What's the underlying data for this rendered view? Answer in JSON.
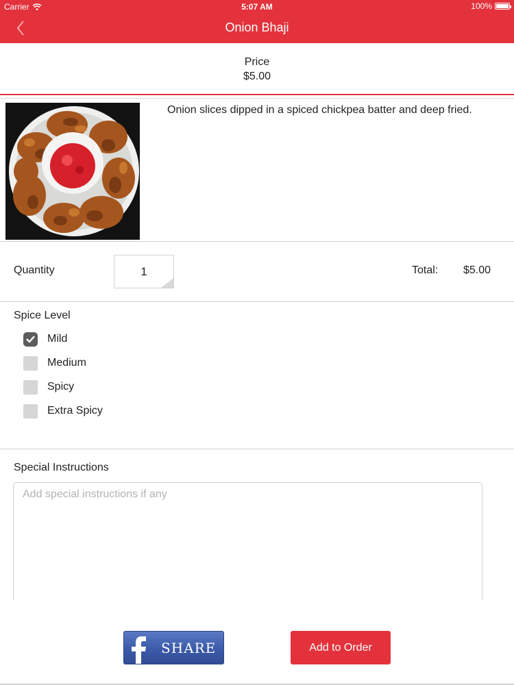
{
  "status_bar": {
    "carrier": "Carrier",
    "time": "5:07 AM",
    "battery": "100%"
  },
  "nav": {
    "title": "Onion Bhaji",
    "back_icon": "chevron-left-icon"
  },
  "price": {
    "label": "Price",
    "value": "$5.00"
  },
  "item": {
    "description": "Onion slices dipped in a spiced chickpea batter and deep fried.",
    "image": "onion-bhaji-plate-with-red-chutney"
  },
  "order": {
    "quantity_label": "Quantity",
    "quantity": "1",
    "total_label": "Total:",
    "total_value": "$5.00"
  },
  "spice": {
    "title": "Spice Level",
    "options": [
      {
        "label": "Mild",
        "checked": true
      },
      {
        "label": "Medium",
        "checked": false
      },
      {
        "label": "Spicy",
        "checked": false
      },
      {
        "label": "Extra Spicy",
        "checked": false
      }
    ]
  },
  "instructions": {
    "title": "Special Instructions",
    "placeholder": "Add special instructions if any",
    "value": ""
  },
  "actions": {
    "share_label": "SHARE",
    "add_to_order_label": "Add to Order"
  },
  "colors": {
    "accent": "#e3323c",
    "facebook": "#3b5aa8"
  }
}
